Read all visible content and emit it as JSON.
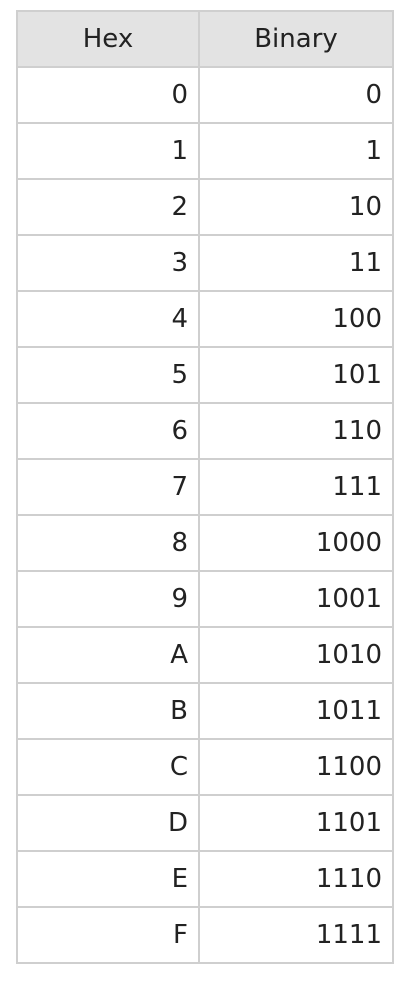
{
  "table": {
    "headers": [
      "Hex",
      "Binary"
    ],
    "rows": [
      [
        "0",
        "0"
      ],
      [
        "1",
        "1"
      ],
      [
        "2",
        "10"
      ],
      [
        "3",
        "11"
      ],
      [
        "4",
        "100"
      ],
      [
        "5",
        "101"
      ],
      [
        "6",
        "110"
      ],
      [
        "7",
        "111"
      ],
      [
        "8",
        "1000"
      ],
      [
        "9",
        "1001"
      ],
      [
        "A",
        "1010"
      ],
      [
        "B",
        "1011"
      ],
      [
        "C",
        "1100"
      ],
      [
        "D",
        "1101"
      ],
      [
        "E",
        "1110"
      ],
      [
        "F",
        "1111"
      ]
    ]
  }
}
